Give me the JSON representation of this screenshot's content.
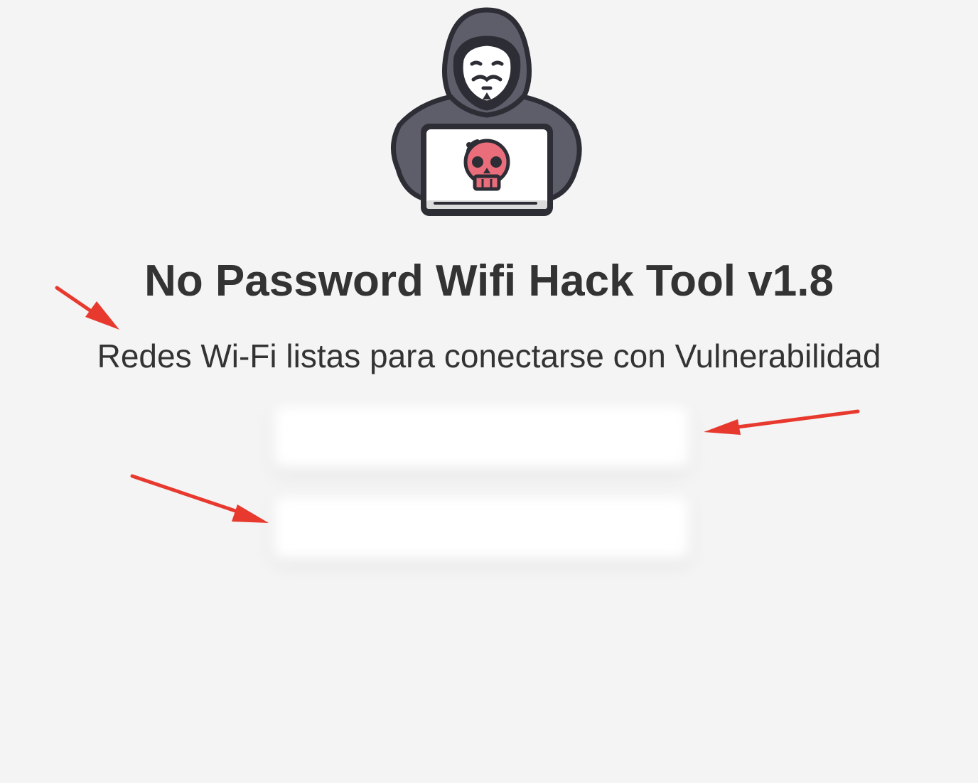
{
  "header": {
    "illustration_icon": "hooded-hacker-laptop-skull-icon",
    "title": "No Password Wifi Hack Tool v1.8",
    "subtitle": "Redes Wi-Fi listas para conectarse con Vulnerabilidad"
  },
  "networks": [
    {
      "label": ""
    },
    {
      "label": ""
    }
  ],
  "annotations": {
    "arrow_icon": "red-arrow-icon",
    "arrow_color": "#e8392f"
  },
  "colors": {
    "background": "#f4f4f4",
    "text": "#333333",
    "hood": "#5d5e6a",
    "outline": "#2d2d36",
    "skull": "#e96d7a"
  }
}
